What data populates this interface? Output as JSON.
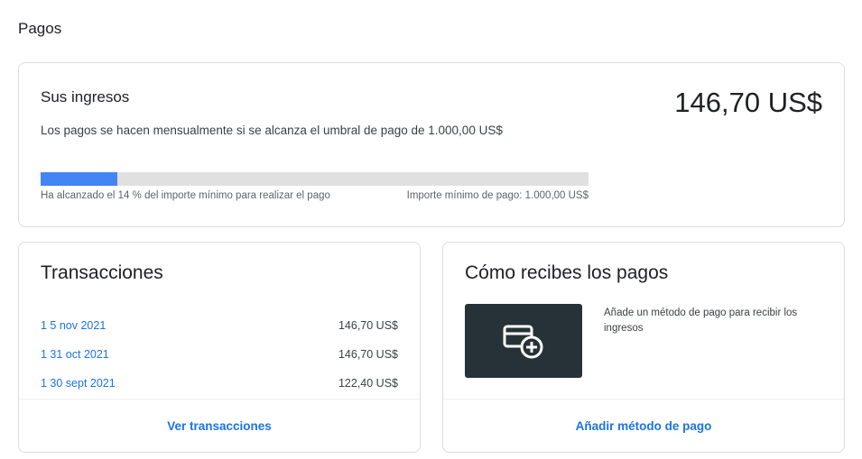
{
  "page": {
    "title": "Pagos"
  },
  "earnings": {
    "heading": "Sus ingresos",
    "description": "Los pagos se hacen mensualmente si se alcanza el umbral de pago de 1.000,00 US$",
    "amount": "146,70 US$",
    "progress": {
      "percent": 14,
      "left_label": "Ha alcanzado el 14 % del importe mínimo para realizar el pago",
      "right_label": "Importe mínimo de pago: 1.000,00 US$",
      "fill_color": "#4285f4",
      "track_color": "#e0e0e0"
    }
  },
  "transactions": {
    "title": "Transacciones",
    "items": [
      {
        "date": "1  5 nov 2021",
        "amount": "146,70 US$"
      },
      {
        "date": "1  31 oct 2021",
        "amount": "146,70 US$"
      },
      {
        "date": "1  30 sept 2021",
        "amount": "122,40 US$"
      }
    ],
    "footer_link": "Ver transacciones"
  },
  "payments": {
    "title": "Cómo recibes los pagos",
    "icon": "add-card-icon",
    "hint": "Añade un método de pago para recibir los ingresos",
    "footer_link": "Añadir método de pago"
  },
  "colors": {
    "link": "#1a73e8",
    "card_visual_bg": "#263238"
  }
}
